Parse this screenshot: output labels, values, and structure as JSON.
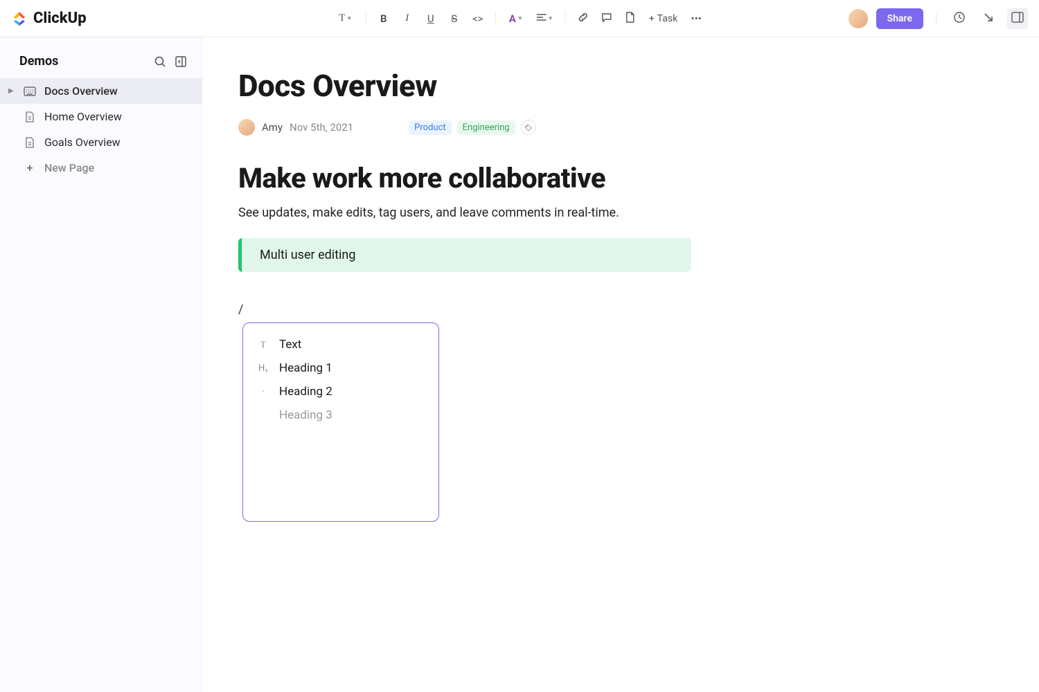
{
  "brand": "ClickUp",
  "toolbar": {
    "task_label": "Task",
    "share_label": "Share"
  },
  "sidebar": {
    "title": "Demos",
    "items": [
      {
        "label": "Docs Overview",
        "active": true
      },
      {
        "label": "Home Overview",
        "active": false
      },
      {
        "label": "Goals Overview",
        "active": false
      }
    ],
    "new_page": "New Page"
  },
  "doc": {
    "title": "Docs Overview",
    "author": "Amy",
    "date": "Nov 5th, 2021",
    "tags": {
      "product": "Product",
      "engineering": "Engineering"
    },
    "heading": "Make work more collaborative",
    "body": "See updates, make edits, tag users, and leave comments in real-time.",
    "callout": "Multi user editing",
    "slash": "/"
  },
  "slash_menu": {
    "items": [
      {
        "label": "Text",
        "icon": "T"
      },
      {
        "label": "Heading 1",
        "icon": "H₁"
      },
      {
        "label": "Heading 2",
        "icon": "·"
      },
      {
        "label": "Heading 3",
        "icon": "",
        "muted": true
      }
    ]
  }
}
